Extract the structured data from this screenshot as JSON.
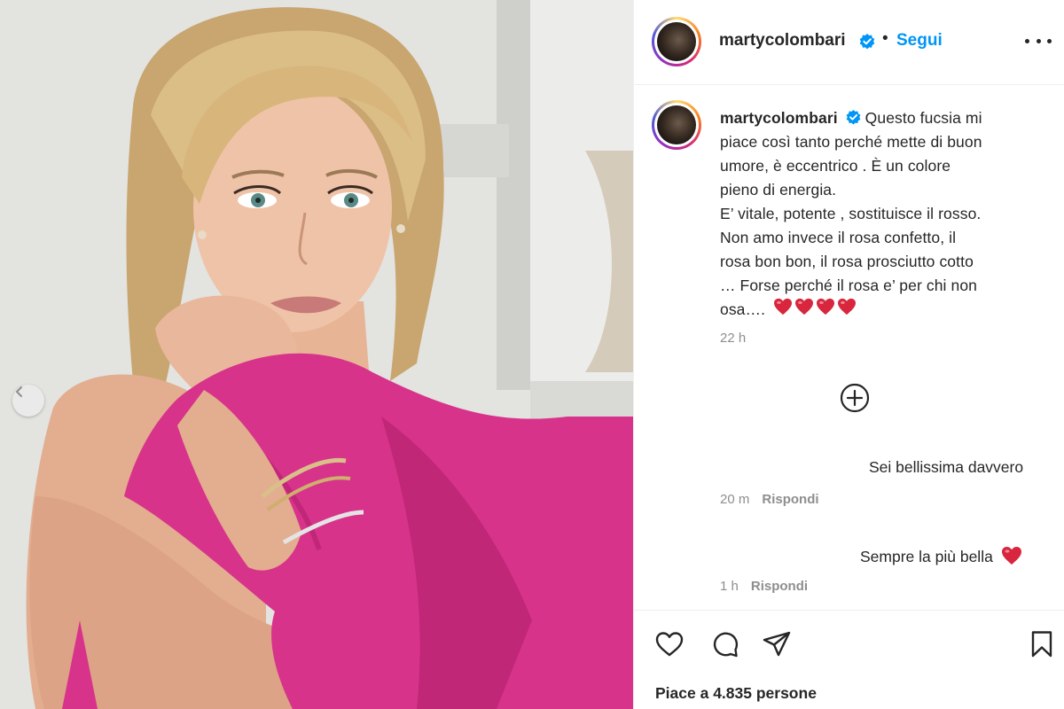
{
  "post": {
    "username": "martycolombari",
    "follow_label": "Segui",
    "separator": "•",
    "caption_lines": [
      "Questo fucsia mi",
      "piace così tanto perché mette di buon",
      "umore, è eccentrico . È un colore",
      "pieno di energia.",
      "E’ vitale, potente , sostituisce il rosso.",
      "Non amo invece il rosa confetto, il",
      "rosa bon bon, il rosa prosciutto cotto",
      "… Forse perché il rosa e’ per chi non",
      "osa…."
    ],
    "caption_time": "22 h",
    "likes_text": "Piace a 4.835 persone"
  },
  "comments": [
    {
      "text": "Sei bellissima davvero",
      "time": "20 m",
      "reply_label": "Rispondi"
    },
    {
      "text": "Sempre la più bella",
      "time": "1 h",
      "reply_label": "Rispondi"
    }
  ],
  "icons": {
    "verified": "verified-badge-icon",
    "more": "more-options-icon",
    "load_more": "plus-circle-icon",
    "like": "heart-icon",
    "comment": "comment-icon",
    "share": "paper-plane-icon",
    "save": "bookmark-icon",
    "carousel_prev": "chevron-left-icon"
  },
  "colors": {
    "accent": "#0095f6",
    "muted": "#8e8e8e",
    "heart": "#e0245e",
    "dress": "#d8338a"
  }
}
